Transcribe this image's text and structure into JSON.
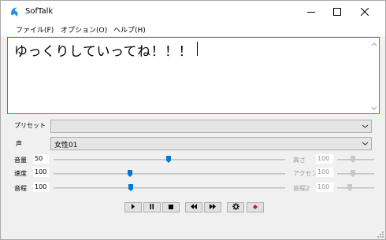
{
  "window": {
    "title": "SofTalk",
    "icons": {
      "app": "softalk-logo-icon",
      "minimize": "minimize-icon",
      "maximize": "maximize-icon",
      "close": "close-icon"
    }
  },
  "menu": {
    "file": "ファイル(F)",
    "options": "オプション(O)",
    "help": "ヘルプ(H)"
  },
  "editor": {
    "text": "ゆっくりしていってね！！！"
  },
  "preset": {
    "label": "プリセット",
    "value": ""
  },
  "voice": {
    "label": "声",
    "value": "女性01"
  },
  "sliders": {
    "volume": {
      "label": "音量",
      "value": "50",
      "level": 0.5
    },
    "speed": {
      "label": "速度",
      "value": "100",
      "level": 0.33
    },
    "pitch": {
      "label": "音程",
      "value": "100",
      "level": 0.33
    },
    "height": {
      "label": "高さ",
      "value": "100",
      "enabled": false
    },
    "accent": {
      "label": "アクセント",
      "value": "100",
      "enabled": false
    },
    "pitch2": {
      "label": "音程2",
      "value": "100",
      "enabled": false
    }
  },
  "transport": {
    "icons": [
      "play-icon",
      "pause-icon",
      "stop-icon",
      "rewind-icon",
      "fast-forward-icon",
      "settings-icon",
      "record-icon"
    ]
  },
  "colors": {
    "accent": "#0078d7",
    "record": "#e01010"
  }
}
